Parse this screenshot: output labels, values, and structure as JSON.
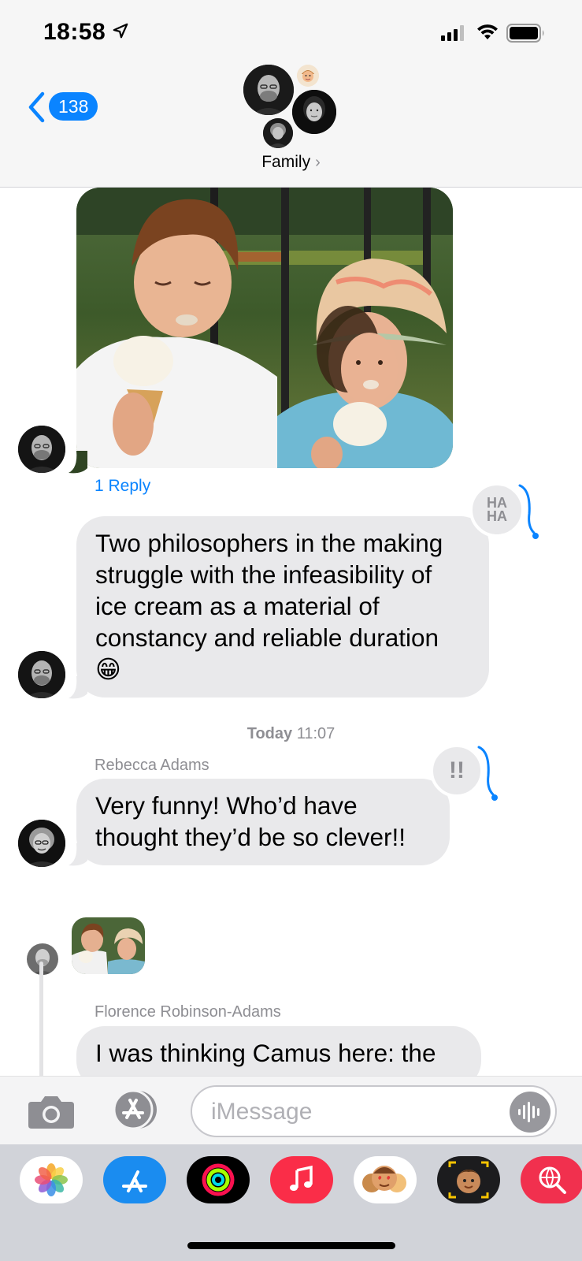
{
  "status_bar": {
    "time": "18:58",
    "icons": [
      "location-arrow-icon",
      "cellular-signal-icon",
      "wifi-icon",
      "battery-icon"
    ]
  },
  "header": {
    "back_count": "138",
    "group_name": "Family",
    "chevron": "›"
  },
  "conversation": {
    "photo_message": {
      "reply_label": "1 Reply"
    },
    "message_1": {
      "text": "Two philosophers in the making struggle with the infeasibility of ice cream as a material of constancy and reliable duration 😁",
      "tapback": "HA\nHA",
      "tapback_icon": "haha-icon"
    },
    "timestamp": {
      "day": "Today",
      "time": "11:07"
    },
    "message_2": {
      "sender": "Rebecca Adams",
      "text": "Very funny! Who’d have thought they’d be so clever!!",
      "tapback": "!!",
      "tapback_icon": "emphasis-icon"
    },
    "message_3": {
      "sender": "Florence Robinson-Adams",
      "text": "I was thinking Camus here: the"
    }
  },
  "input_bar": {
    "placeholder": "iMessage"
  },
  "app_drawer": {
    "apps": [
      "photos-app-icon",
      "app-store-icon",
      "activity-app-icon",
      "music-app-icon",
      "memoji-stickers-icon",
      "memoji-icon",
      "web-search-icon"
    ]
  },
  "colors": {
    "accent": "#0a84ff",
    "bubble": "#e9e9eb",
    "secondary_text": "#8e8e93",
    "drawer": "#d1d3d9"
  }
}
